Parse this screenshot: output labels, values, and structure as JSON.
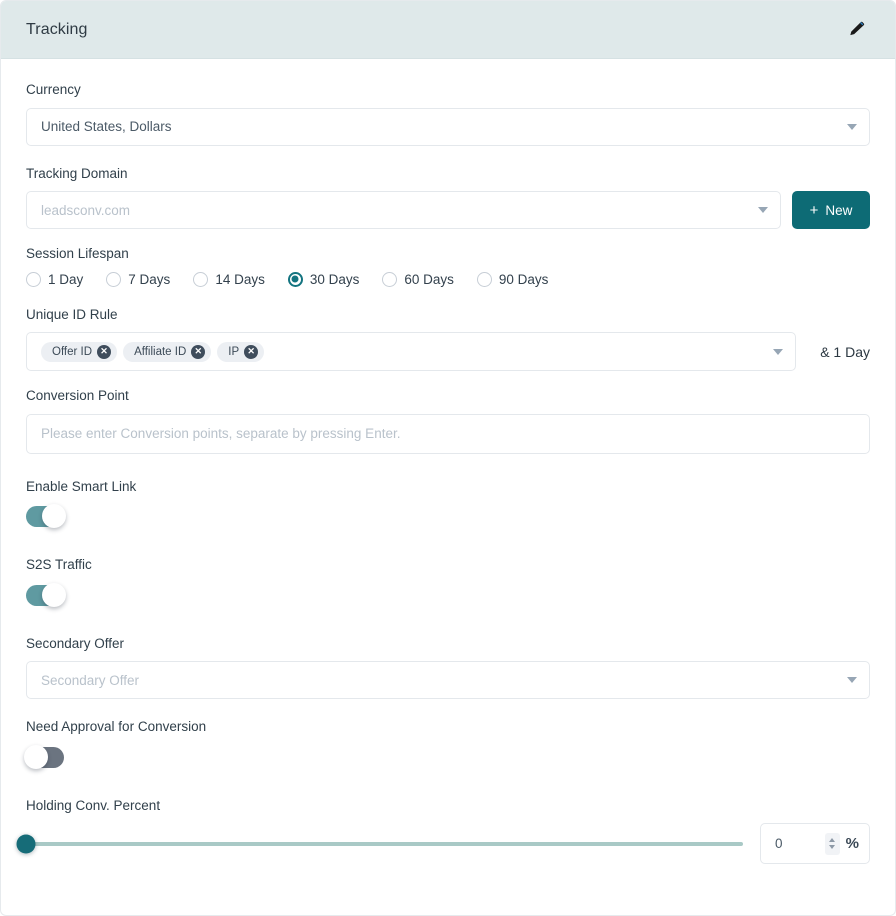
{
  "header": {
    "title": "Tracking",
    "edit_icon": "pencil-icon",
    "bg_color": "#dfe9ea"
  },
  "theme": {
    "accent": "#0d6b75",
    "toggle_on": "#5f9aa1",
    "toggle_off": "#6b7480",
    "slider_track": "#a9c9c6",
    "slider_handle": "#166c78"
  },
  "fields": {
    "currency": {
      "label": "Currency",
      "value": "United States, Dollars",
      "caret_icon": "chevron-down-icon"
    },
    "tracking_domain": {
      "label": "Tracking Domain",
      "placeholder": "leadsconv.com",
      "value": "",
      "caret_icon": "chevron-down-icon",
      "new_button": {
        "label": "New",
        "plus_icon": "plus-icon"
      }
    },
    "session_lifespan": {
      "label": "Session Lifespan",
      "options": [
        {
          "label": "1 Day",
          "selected": false
        },
        {
          "label": "7 Days",
          "selected": false
        },
        {
          "label": "14 Days",
          "selected": false
        },
        {
          "label": "30 Days",
          "selected": true
        },
        {
          "label": "60 Days",
          "selected": false
        },
        {
          "label": "90 Days",
          "selected": false
        }
      ],
      "selected_value": "30 Days"
    },
    "unique_id_rule": {
      "label": "Unique ID Rule",
      "tags": [
        {
          "label": "Offer ID",
          "remove_icon": "close-icon"
        },
        {
          "label": "Affiliate ID",
          "remove_icon": "close-icon"
        },
        {
          "label": "IP",
          "remove_icon": "close-icon"
        }
      ],
      "caret_icon": "chevron-down-icon",
      "suffix": "& 1 Day"
    },
    "conversion_point": {
      "label": "Conversion Point",
      "placeholder": "Please enter Conversion points, separate by pressing Enter.",
      "value": ""
    },
    "enable_smart_link": {
      "label": "Enable Smart Link",
      "state": "on"
    },
    "s2s_traffic": {
      "label": "S2S Traffic",
      "state": "on"
    },
    "secondary_offer": {
      "label": "Secondary Offer",
      "placeholder": "Secondary Offer",
      "value": "",
      "caret_icon": "chevron-down-icon"
    },
    "need_approval_for_conversion": {
      "label": "Need Approval for Conversion",
      "state": "off"
    },
    "holding_conv_percent": {
      "label": "Holding Conv. Percent",
      "value": "0",
      "min": 0,
      "max": 100,
      "unit": "%",
      "spinner_up_icon": "chevron-up-icon",
      "spinner_down_icon": "chevron-down-icon"
    }
  }
}
